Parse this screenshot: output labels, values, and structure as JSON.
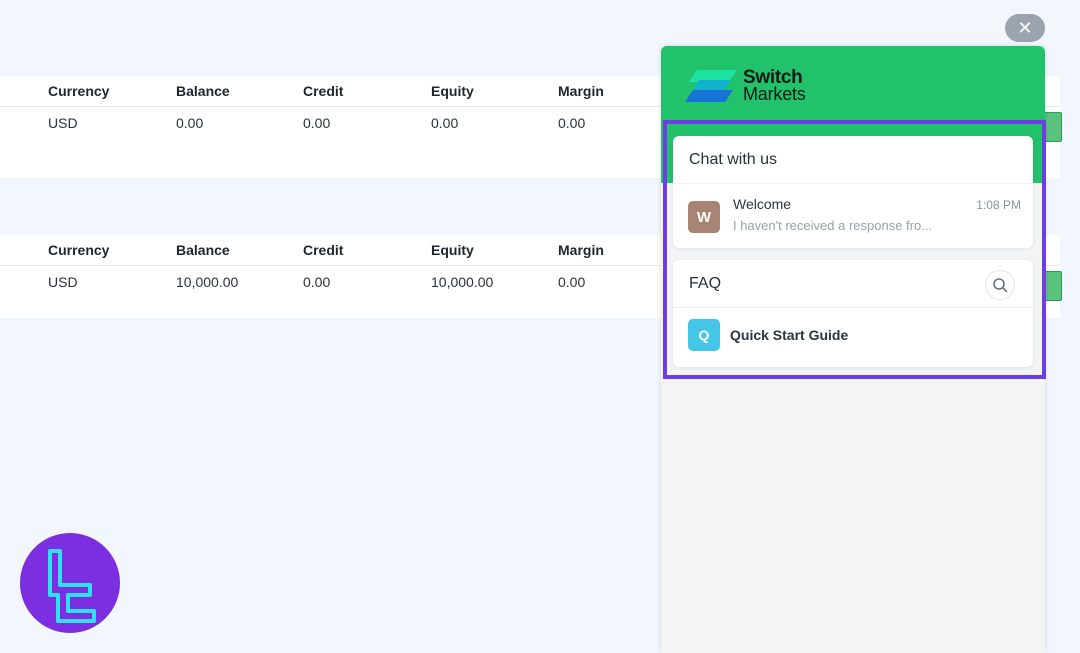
{
  "tables": [
    {
      "headers": [
        "Currency",
        "Balance",
        "Credit",
        "Equity",
        "Margin"
      ],
      "row": [
        "USD",
        "0.00",
        "0.00",
        "0.00",
        "0.00"
      ]
    },
    {
      "headers": [
        "Currency",
        "Balance",
        "Credit",
        "Equity",
        "Margin"
      ],
      "row": [
        "USD",
        "10,000.00",
        "0.00",
        "10,000.00",
        "0.00"
      ]
    }
  ],
  "widget": {
    "brand": {
      "line1": "Switch",
      "line2": "Markets"
    },
    "chat_card": {
      "title": "Chat with us",
      "message": {
        "avatar_letter": "W",
        "sender": "Welcome",
        "time": "1:08 PM",
        "preview": "I haven't received a response fro..."
      }
    },
    "faq_card": {
      "title": "FAQ",
      "items": [
        {
          "avatar_letter": "Q",
          "label": "Quick Start Guide"
        }
      ]
    }
  },
  "colors": {
    "widget_header": "#22c16b",
    "highlight_frame": "#6e3fe0",
    "avatar_w": "#a78474",
    "avatar_q": "#45c6e6",
    "page_bg": "#f2f7fd"
  },
  "icons": {
    "close": "close-icon",
    "search": "search-icon",
    "brand": "switch-markets-logo-icon",
    "watermark": "tradingfinder-logo-icon"
  }
}
